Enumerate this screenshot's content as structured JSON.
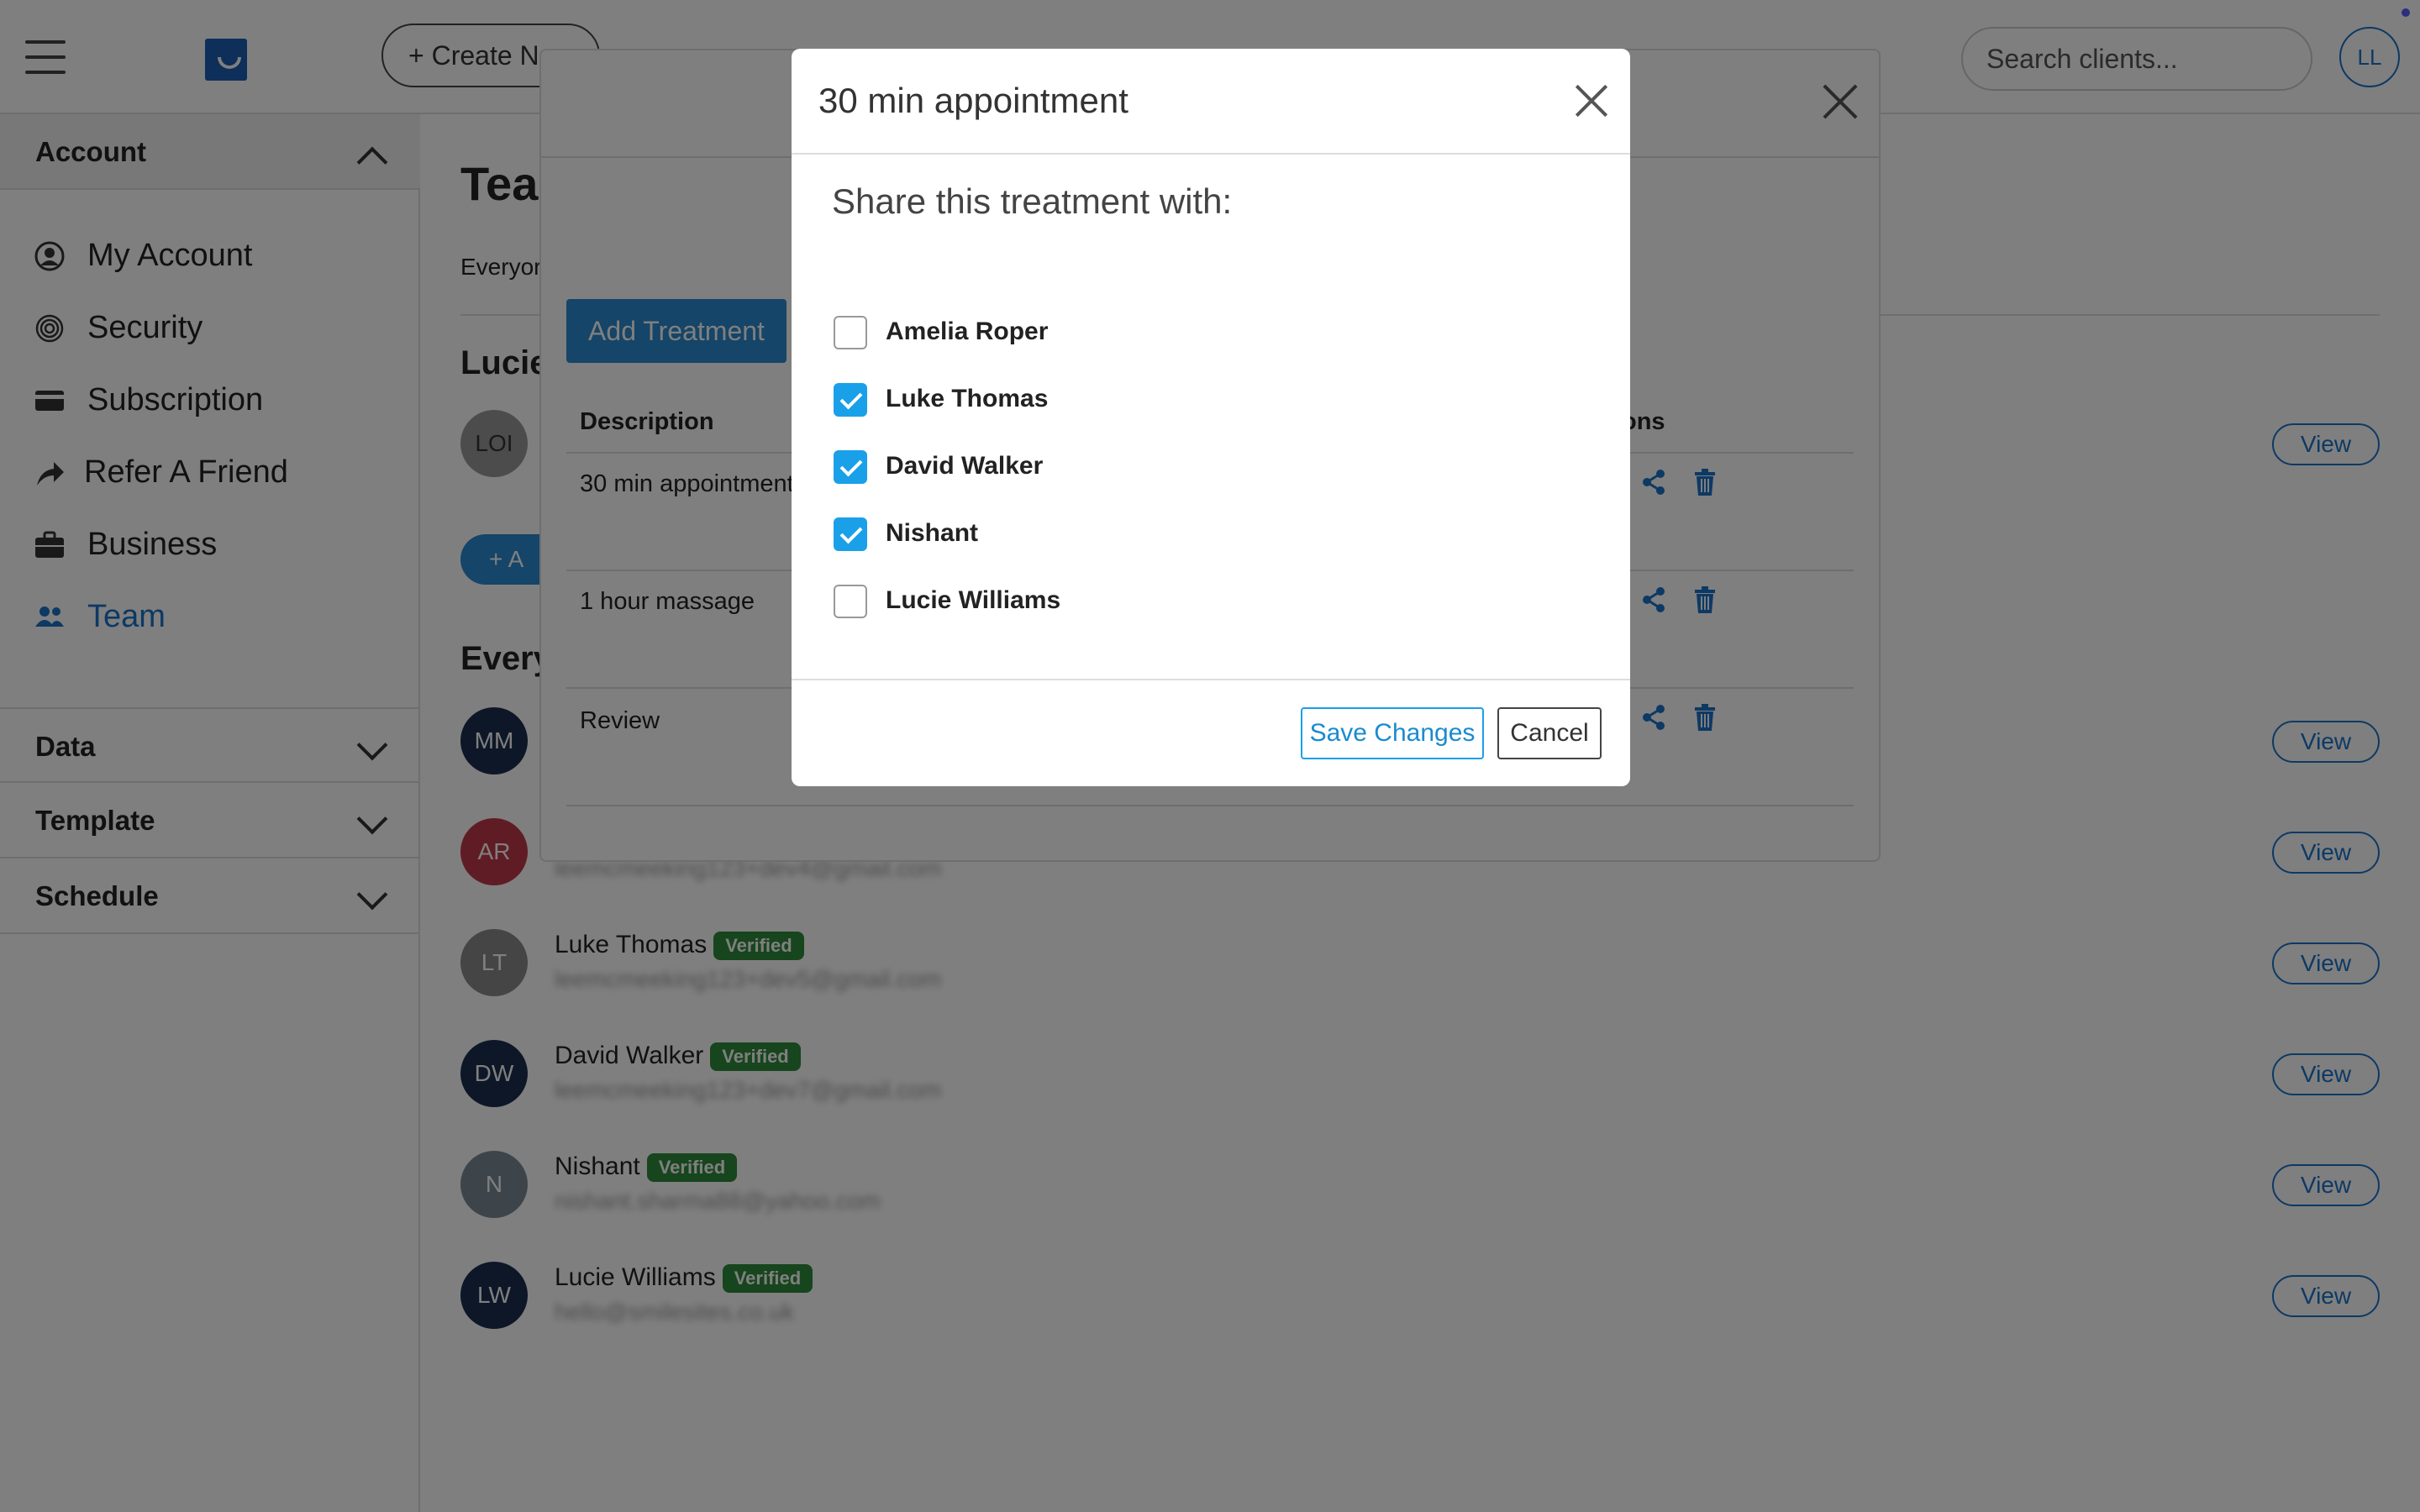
{
  "topbar": {
    "create_label": "+ Create N",
    "search_placeholder": "Search clients...",
    "user_initials": "LL"
  },
  "sidebar": {
    "account_header": "Account",
    "items": [
      {
        "label": "My Account",
        "icon": "user-circle-icon"
      },
      {
        "label": "Security",
        "icon": "fingerprint-icon"
      },
      {
        "label": "Subscription",
        "icon": "credit-card-icon"
      },
      {
        "label": "Refer A Friend",
        "icon": "share-arrow-icon"
      },
      {
        "label": "Business",
        "icon": "briefcase-icon"
      },
      {
        "label": "Team",
        "icon": "team-icon"
      }
    ],
    "sections": [
      "Data",
      "Template",
      "Schedule"
    ]
  },
  "main": {
    "page_title": "Tea",
    "intro_text": "Everyor",
    "section_lucie": "Lucie",
    "section_everyone": "Every",
    "add_label": "+ A",
    "view_label": "View",
    "lucie_initials": "LOI",
    "members": [
      {
        "initials": "MM",
        "color": "#1c2f4f",
        "name": "",
        "verified": false,
        "email": ""
      },
      {
        "initials": "AR",
        "color": "#c0394b",
        "name": "",
        "verified": false,
        "email": "leemcmeeking123+dev4@gmail.com"
      },
      {
        "initials": "LT",
        "color": "#8a8a8a",
        "name": "Luke Thomas",
        "verified": true,
        "email": "leemcmeeking123+dev5@gmail.com"
      },
      {
        "initials": "DW",
        "color": "#1c2f4f",
        "name": "David Walker",
        "verified": true,
        "email": "leemcmeeking123+dev7@gmail.com"
      },
      {
        "initials": "N",
        "color": "#7a8a96",
        "name": "Nishant",
        "verified": true,
        "email": "nishant.sharma88@yahoo.com"
      },
      {
        "initials": "LW",
        "color": "#1c2f4f",
        "name": "Lucie Williams",
        "verified": true,
        "email": "hello@smilesites.co.uk"
      }
    ],
    "verified_label": "Verified"
  },
  "treatments_modal": {
    "add_treatment_label": "Add Treatment",
    "col_description": "Description",
    "col_actions": "ons",
    "rows": [
      "30 min appointment",
      "1 hour massage",
      "Review"
    ]
  },
  "dialog": {
    "title": "30 min appointment",
    "subtitle": "Share this treatment with:",
    "options": [
      {
        "label": "Amelia Roper",
        "checked": false
      },
      {
        "label": "Luke Thomas",
        "checked": true
      },
      {
        "label": "David Walker",
        "checked": true
      },
      {
        "label": "Nishant",
        "checked": true
      },
      {
        "label": "Lucie Williams",
        "checked": false
      }
    ],
    "save_label": "Save Changes",
    "cancel_label": "Cancel"
  }
}
